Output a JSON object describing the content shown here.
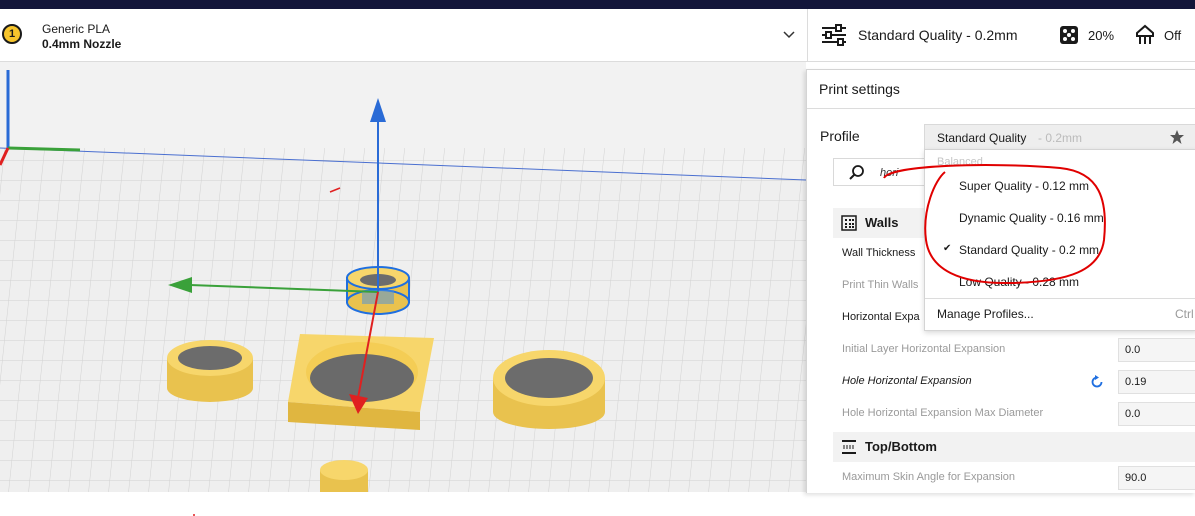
{
  "header": {
    "extruder_number": "1",
    "material": "Generic PLA",
    "nozzle": "0.4mm Nozzle",
    "quality": "Standard Quality - 0.2mm",
    "infill": "20%",
    "support": "Off"
  },
  "panel": {
    "title": "Print settings",
    "profile_label": "Profile",
    "profile_name": "Standard Quality",
    "profile_layer": " - 0.2mm",
    "search_text": "hori",
    "categories": [
      {
        "label": "Walls",
        "icon": "walls-icon"
      },
      {
        "label": "Top/Bottom",
        "icon": "top-bottom-icon"
      }
    ],
    "settings": [
      {
        "label": "Wall Thickness",
        "value": ""
      },
      {
        "label": "Print Thin Walls",
        "value": ""
      },
      {
        "label": "Horizontal Expa",
        "value": ""
      },
      {
        "label": "Initial Layer Horizontal Expansion",
        "value": "0.0"
      },
      {
        "label": "Hole Horizontal Expansion",
        "value": "0.19"
      },
      {
        "label": "Hole Horizontal Expansion Max Diameter",
        "value": "0.0"
      },
      {
        "label": "Maximum Skin Angle for Expansion",
        "value": "90.0"
      }
    ]
  },
  "dropdown": {
    "section": "Balanced",
    "items": [
      {
        "label": "Super Quality - 0.12 mm",
        "check": ""
      },
      {
        "label": "Dynamic Quality - 0.16 mm",
        "check": ""
      },
      {
        "label": "Standard Quality - 0.2 mm",
        "check": "✔"
      },
      {
        "label": "Low Quality - 0.28 mm",
        "check": ""
      }
    ],
    "manage": "Manage Profiles...",
    "shortcut": "Ctrl"
  },
  "colors": {
    "header_stripe": "#13163a",
    "model_yellow": "#f7d66b",
    "annotation_red": "#e00000",
    "selection_blue": "#1f6fe0"
  }
}
